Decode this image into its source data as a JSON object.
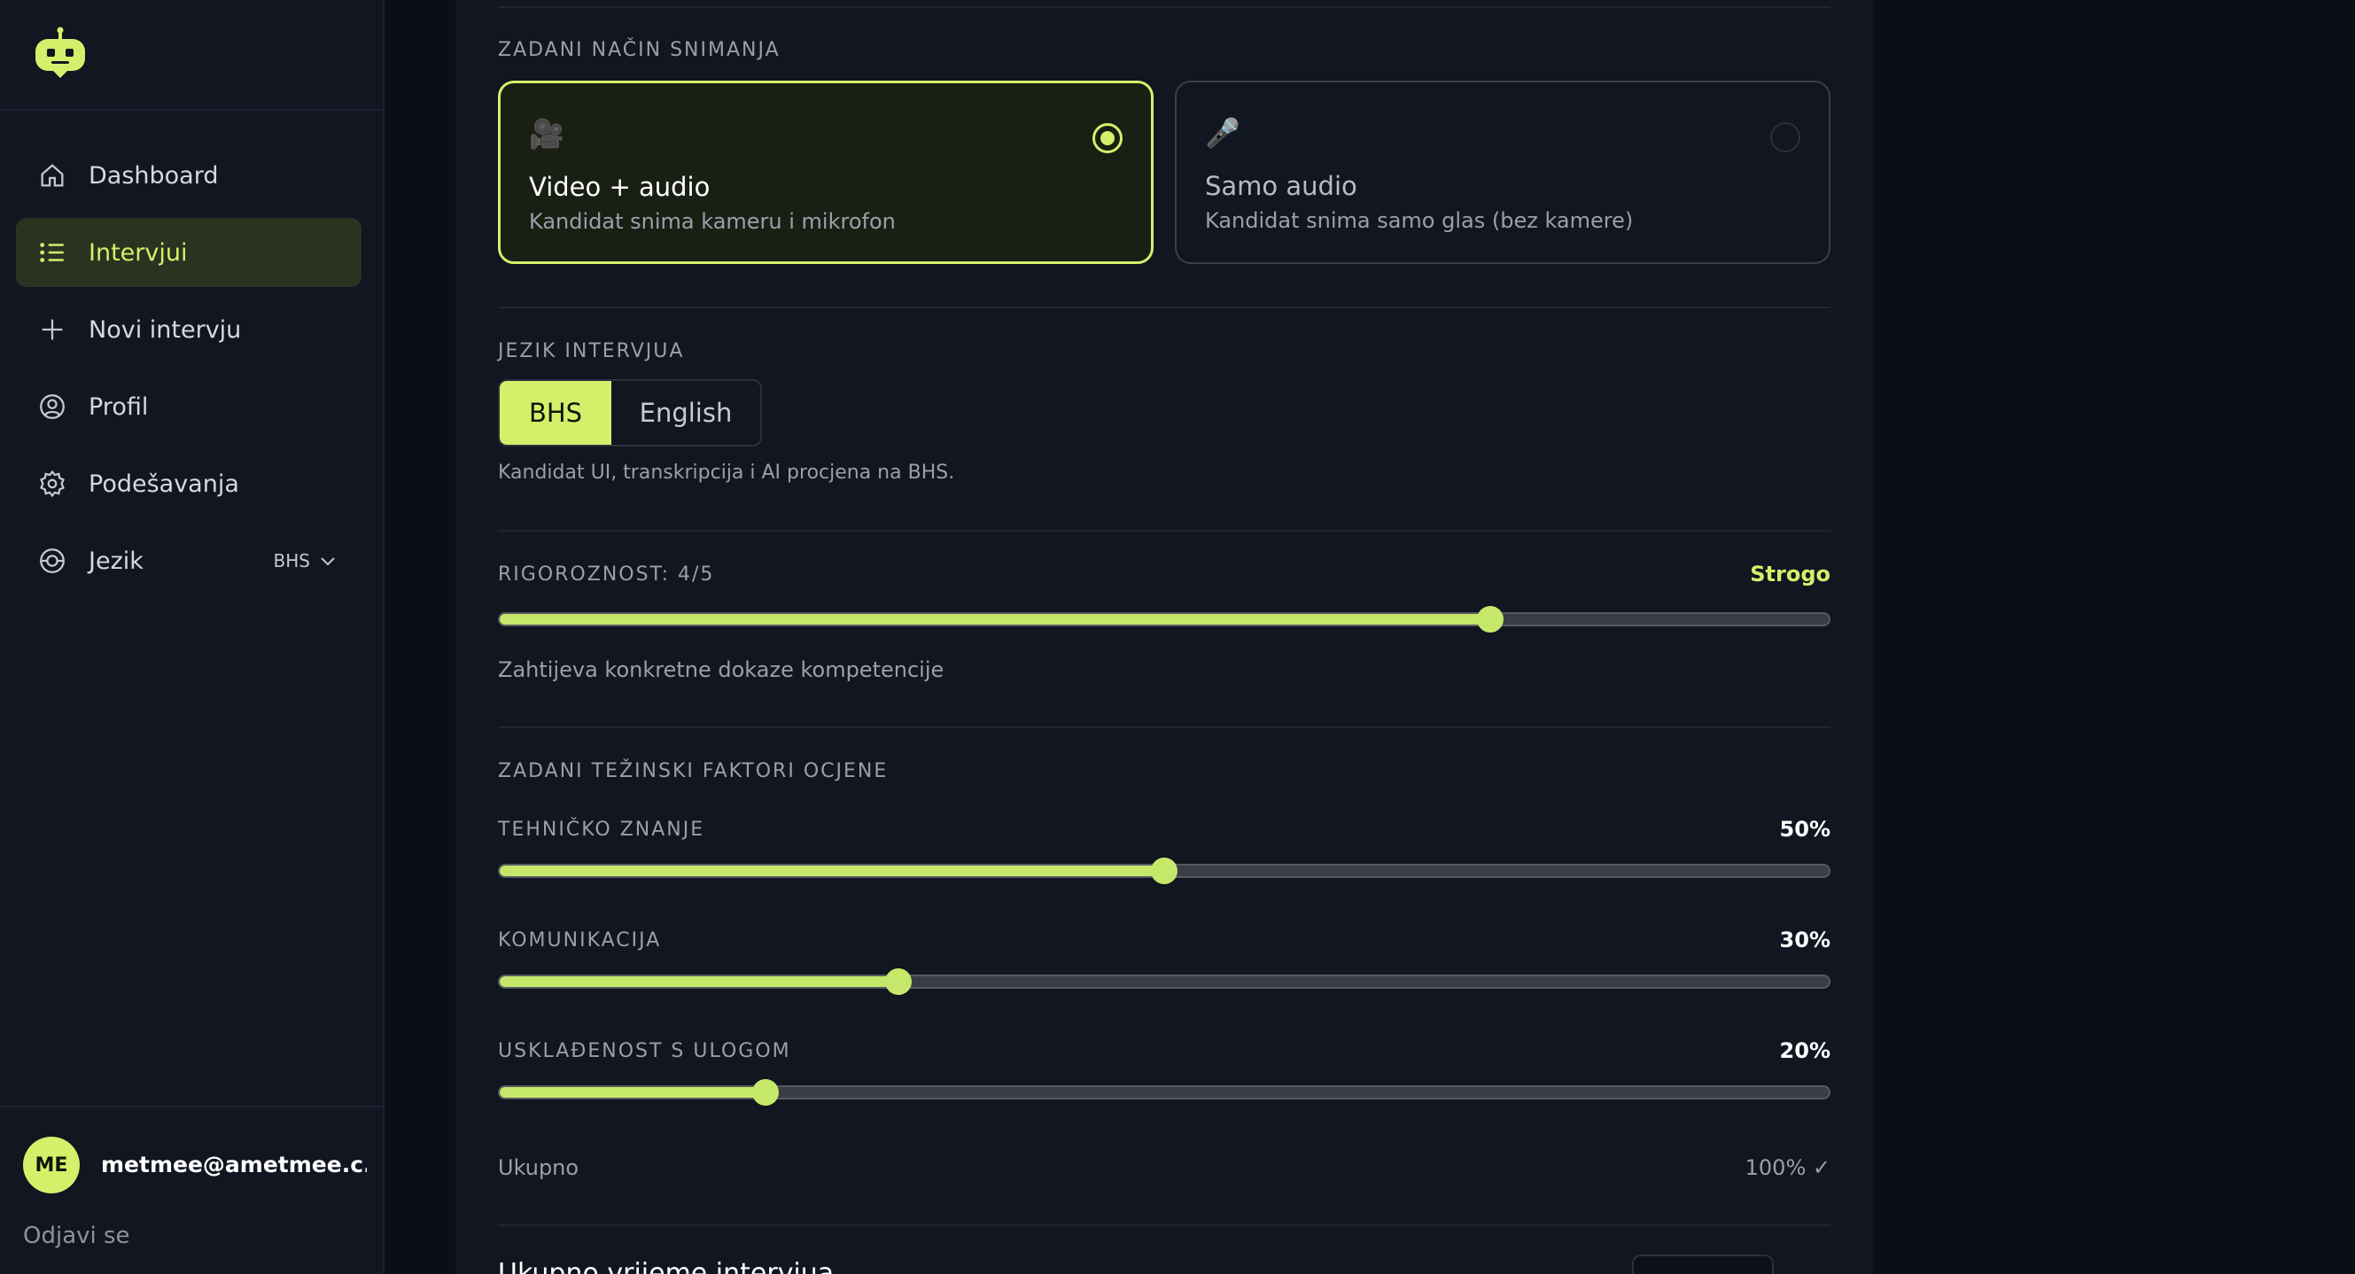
{
  "sidebar": {
    "items": [
      {
        "label": "Dashboard",
        "icon": "home-icon"
      },
      {
        "label": "Intervjui",
        "icon": "list-icon",
        "active": true
      },
      {
        "label": "Novi intervju",
        "icon": "plus-icon"
      },
      {
        "label": "Profil",
        "icon": "user-circle-icon"
      },
      {
        "label": "Podešavanja",
        "icon": "gear-icon"
      },
      {
        "label": "Jezik",
        "icon": "globe-icon"
      }
    ],
    "language_value": "BHS",
    "user": {
      "initials": "ME",
      "email": "metmee@ametmee.c..."
    },
    "logout_label": "Odjavi se"
  },
  "recording": {
    "section_label": "ZADANI NAČIN SNIMANJA",
    "options": [
      {
        "icon": "🎥",
        "title": "Video + audio",
        "subtitle": "Kandidat snima kameru i mikrofon",
        "selected": true
      },
      {
        "icon": "🎤",
        "title": "Samo audio",
        "subtitle": "Kandidat snima samo glas (bez kamere)",
        "selected": false
      }
    ]
  },
  "language": {
    "section_label": "JEZIK INTERVJUA",
    "options": [
      "BHS",
      "English"
    ],
    "selected": "BHS",
    "hint": "Kandidat UI, transkripcija i AI procjena na BHS."
  },
  "rigor": {
    "label": "RIGOROZNOST: 4/5",
    "level_text": "Strogo",
    "value": 4,
    "max": 5,
    "fraction": 0.745,
    "description": "Zahtijeva konkretne dokaze kompetencije"
  },
  "weights": {
    "section_label": "ZADANI TEŽINSKI FAKTORI OCJENE",
    "items": [
      {
        "label": "TEHNIČKO ZNANJE",
        "value_text": "50%",
        "value": 50
      },
      {
        "label": "KOMUNIKACIJA",
        "value_text": "30%",
        "value": 30
      },
      {
        "label": "USKLAĐENOST S ULOGOM",
        "value_text": "20%",
        "value": 20
      }
    ],
    "total_label": "Ukupno",
    "total_value": "100% ✓"
  },
  "duration": {
    "label": "Ukupno vrijeme intervjua"
  },
  "colors": {
    "accent": "#d4f06a",
    "background": "#0b0e14",
    "panel": "#111621"
  }
}
